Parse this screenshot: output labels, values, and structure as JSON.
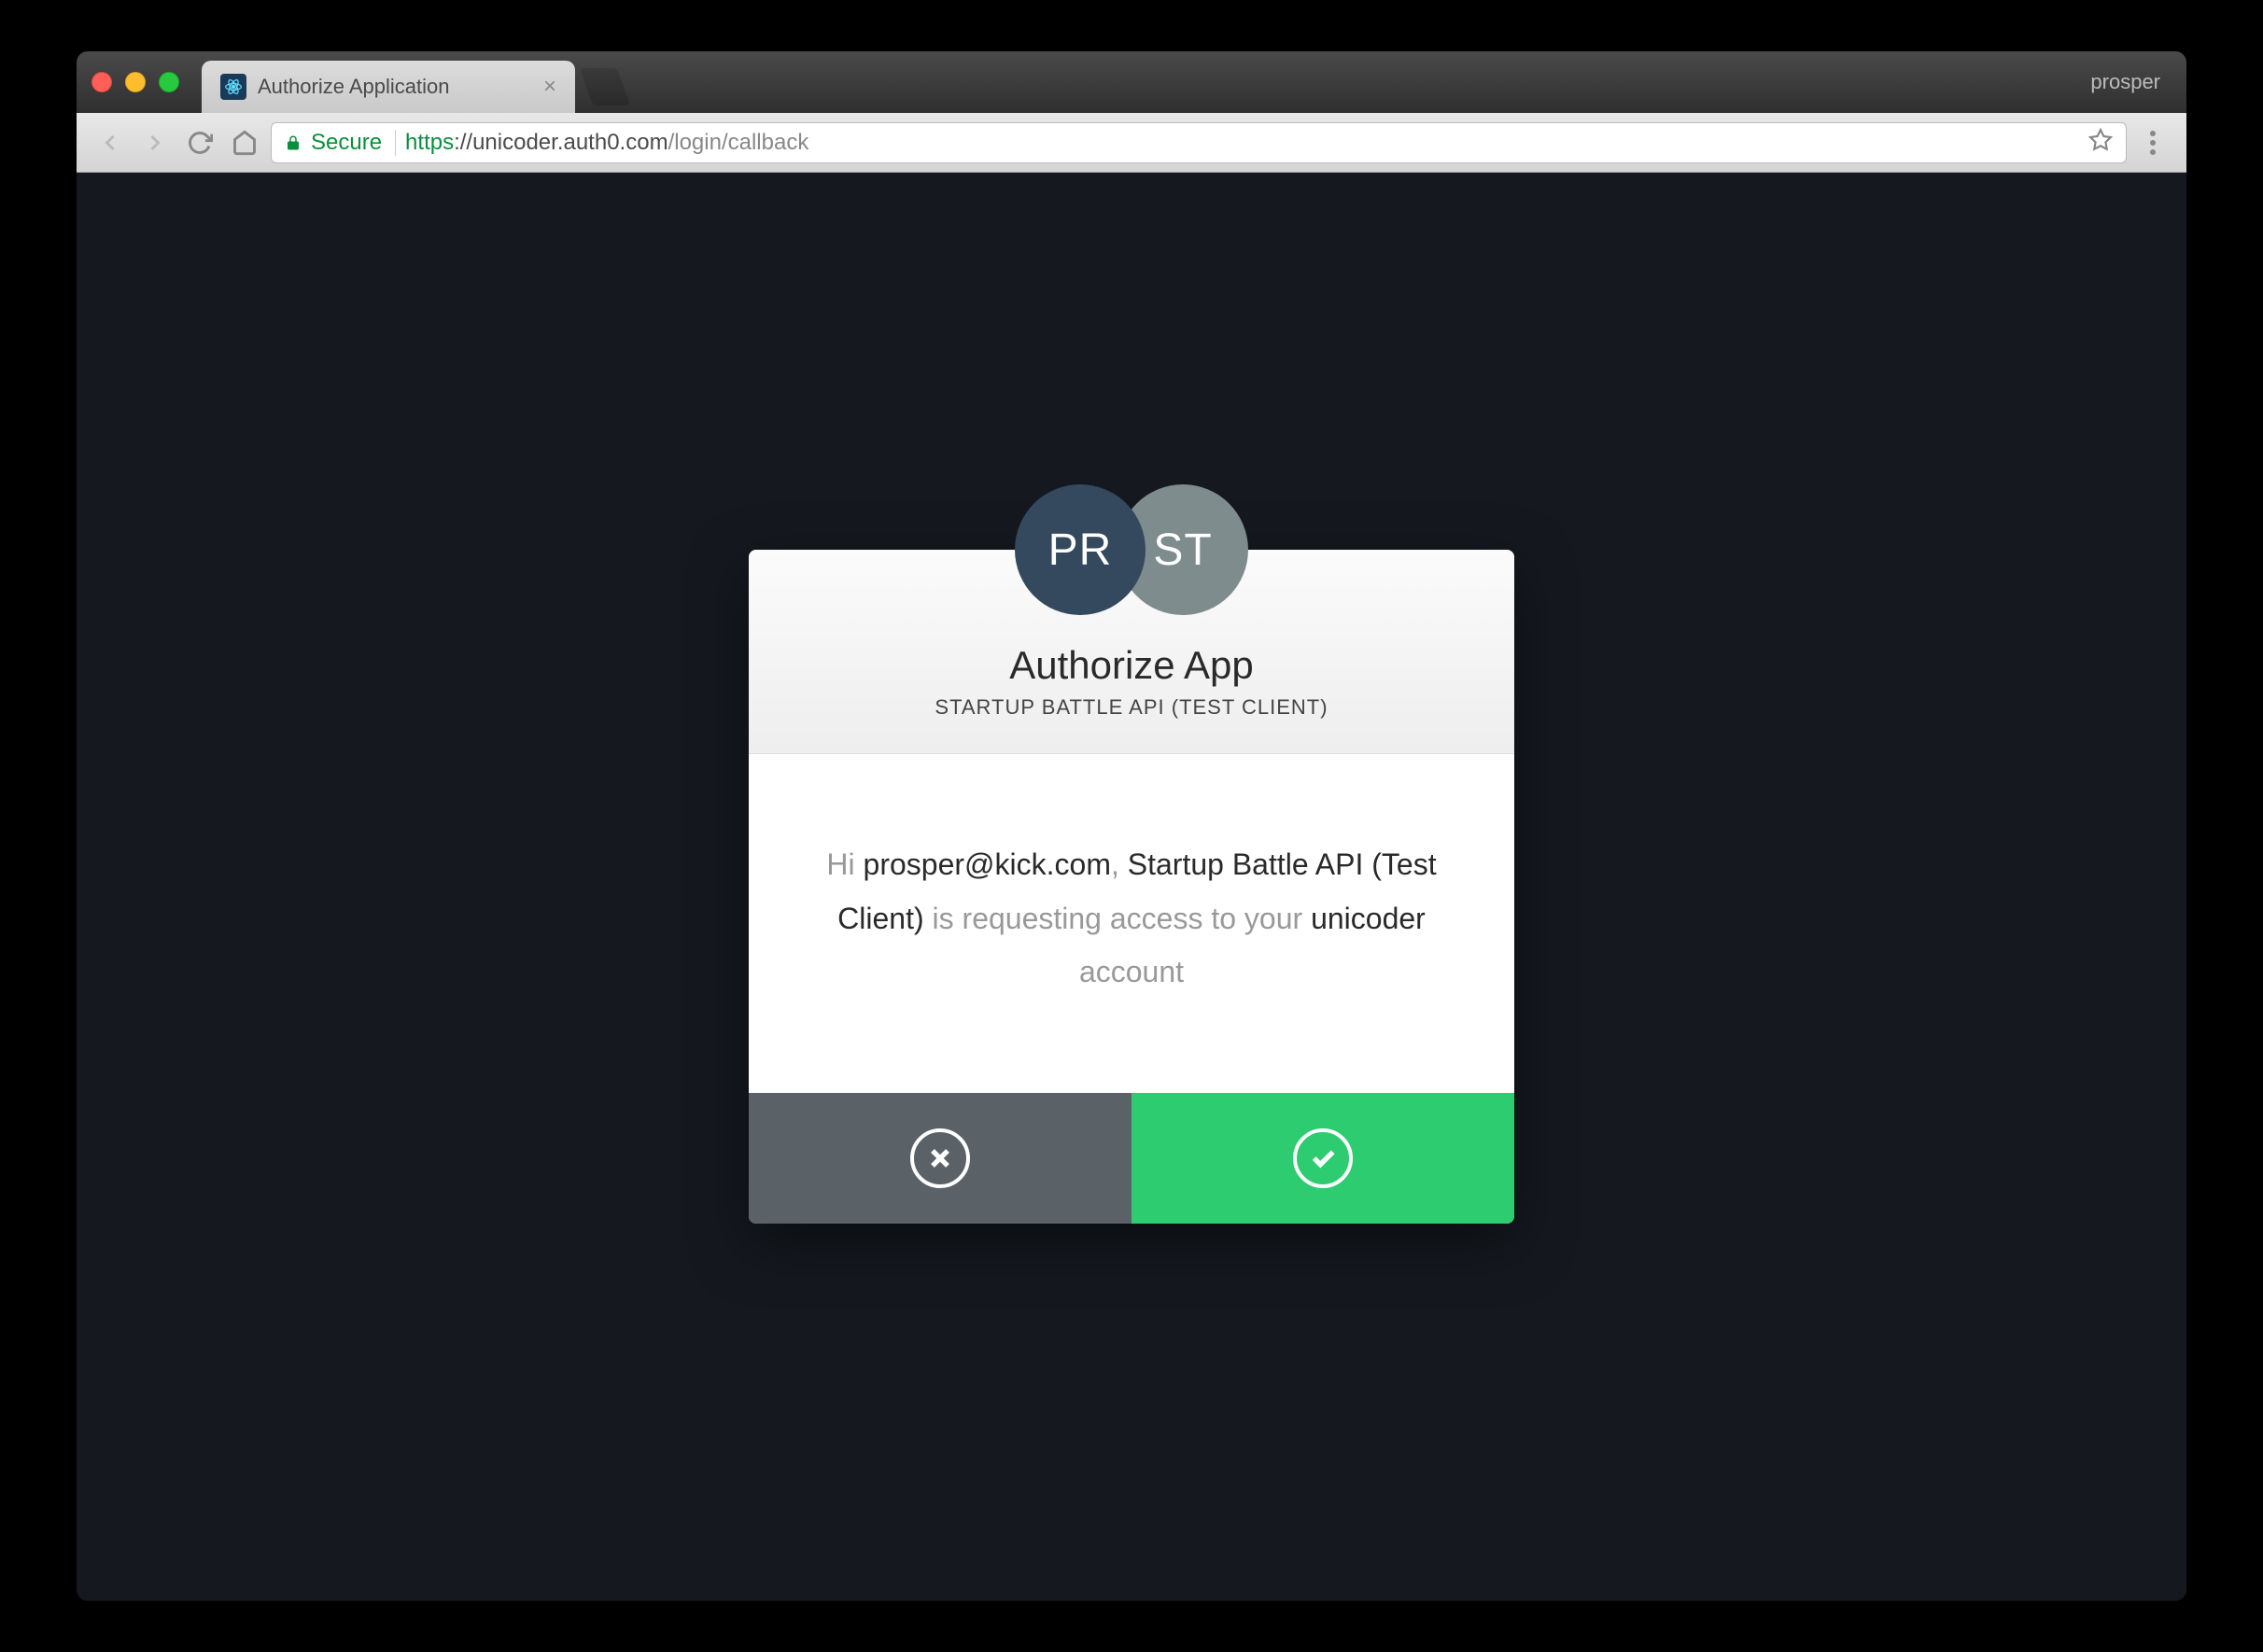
{
  "browser": {
    "tab_title": "Authorize Application",
    "profile_name": "prosper",
    "secure_label": "Secure",
    "url_scheme": "https",
    "url_host": "://unicoder.auth0.com",
    "url_path": "/login/callback"
  },
  "avatars": {
    "user_initials": "PR",
    "app_initials": "ST"
  },
  "header": {
    "title": "Authorize App",
    "subtitle": "STARTUP BATTLE API (TEST CLIENT)"
  },
  "body": {
    "greeting": "Hi ",
    "user_email": "prosper@kick.com",
    "sep1": ", ",
    "client_name": "Startup Battle API (Test Client)",
    "requesting": " is requesting access to your ",
    "tenant_name": "unicoder",
    "account_word": " account"
  },
  "actions": {
    "deny_label": "Deny",
    "allow_label": "Allow"
  }
}
